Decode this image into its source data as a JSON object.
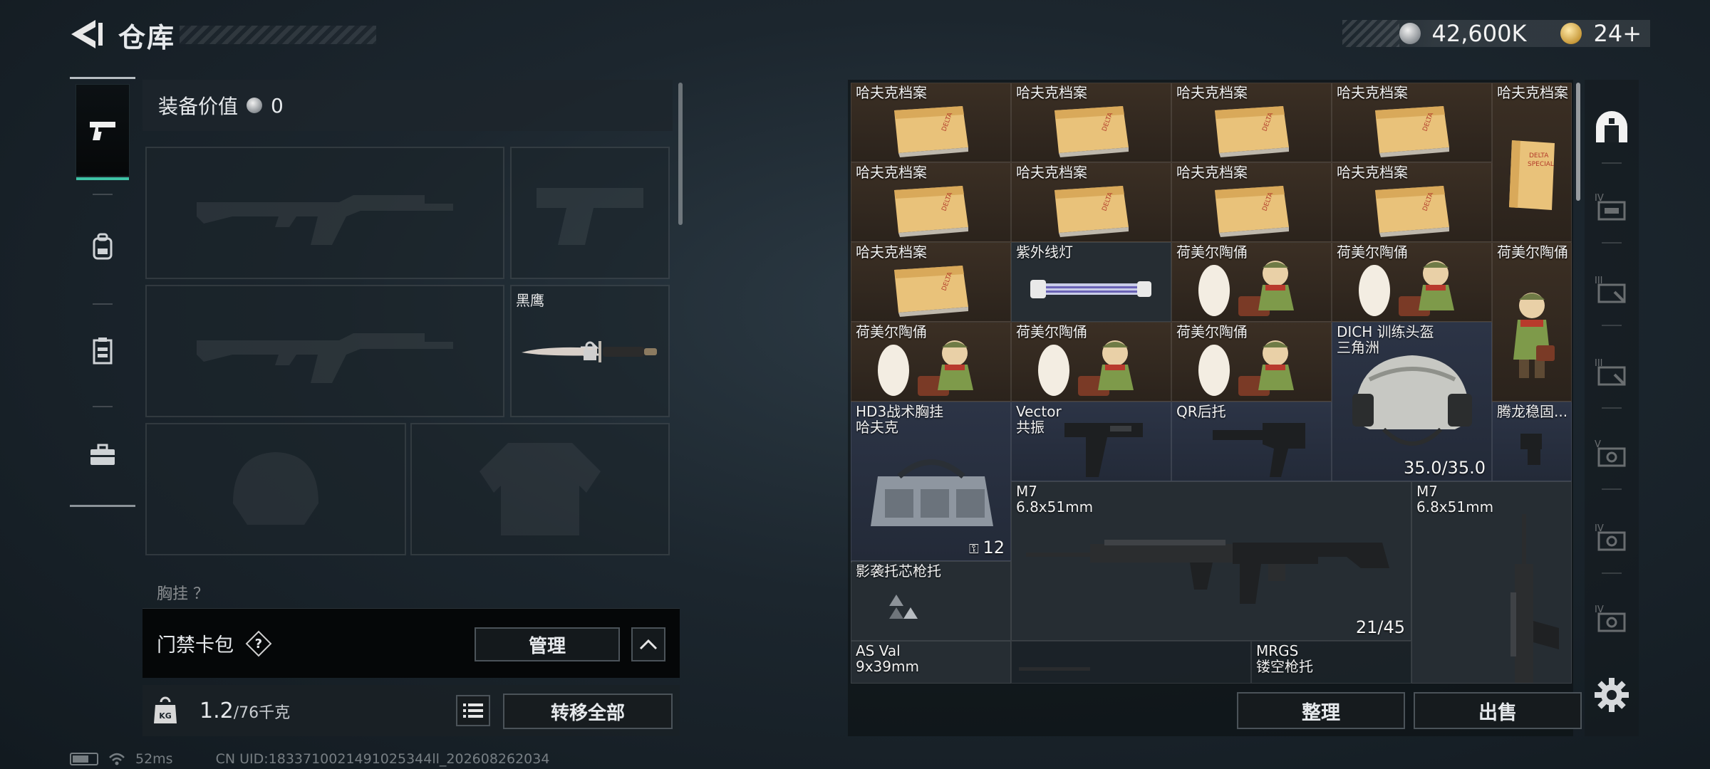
{
  "header": {
    "title": "仓库",
    "currency": [
      {
        "icon": "silver-coin-icon",
        "value": "42,600K"
      },
      {
        "icon": "gold-triangle-coin-icon",
        "value": "24+"
      }
    ]
  },
  "left_tabs": [
    {
      "icon": "pistol-icon",
      "active": true
    },
    {
      "icon": "backpack-icon",
      "active": false
    },
    {
      "icon": "vest-icon",
      "active": false
    },
    {
      "icon": "toolbox-icon",
      "active": false
    }
  ],
  "equipment": {
    "value_label": "装备价值",
    "value": "0",
    "melee_slot_label": "黑鹰",
    "chest_label": "胸挂 ？"
  },
  "keycard": {
    "title": "门禁卡包",
    "help": "?",
    "manage_label": "管理"
  },
  "capacity": {
    "current": "1.2",
    "max": "/76千克",
    "transfer_label": "转移全部"
  },
  "inventory": {
    "items": [
      {
        "name": "哈夫克档案",
        "type": "file",
        "color": "brown"
      },
      {
        "name": "哈夫克档案",
        "type": "file",
        "color": "brown"
      },
      {
        "name": "哈夫克档案",
        "type": "file",
        "color": "brown"
      },
      {
        "name": "哈夫克档案",
        "type": "file",
        "color": "brown"
      },
      {
        "name": "哈夫克档案",
        "type": "file-tall",
        "color": "brown"
      },
      {
        "name": "哈夫克档案",
        "type": "file",
        "color": "brown"
      },
      {
        "name": "哈夫克档案",
        "type": "file",
        "color": "brown"
      },
      {
        "name": "哈夫克档案",
        "type": "file",
        "color": "brown"
      },
      {
        "name": "哈夫克档案",
        "type": "file",
        "color": "brown"
      },
      {
        "name": "哈夫克档案",
        "type": "file",
        "color": "brown"
      },
      {
        "name": "紫外线灯",
        "type": "uv-lamp",
        "color": "dark"
      },
      {
        "name": "荷美尔陶俑",
        "type": "figurine",
        "color": "brown"
      },
      {
        "name": "荷美尔陶俑",
        "type": "figurine",
        "color": "brown"
      },
      {
        "name": "荷美尔陶俑",
        "type": "figurine-tall",
        "color": "brown"
      },
      {
        "name": "荷美尔陶俑",
        "type": "figurine",
        "color": "brown"
      },
      {
        "name": "荷美尔陶俑",
        "type": "figurine",
        "color": "brown"
      },
      {
        "name": "荷美尔陶俑",
        "type": "figurine",
        "color": "brown"
      },
      {
        "name": "DICH 训练头盔",
        "sub": "三角洲",
        "type": "helmet",
        "color": "blue",
        "qty": "35.0/35.0"
      },
      {
        "name": "HD3战术胸挂",
        "sub": "哈夫克",
        "type": "bag",
        "color": "blue",
        "qty": "12"
      },
      {
        "name": "Vector",
        "sub": "共振",
        "type": "grip",
        "color": "blue"
      },
      {
        "name": "QR后托",
        "type": "stock",
        "color": "blue"
      },
      {
        "name": "腾龙稳固...",
        "type": "small-part",
        "color": "blue"
      },
      {
        "name": "M7",
        "sub": "6.8x51mm",
        "type": "rifle",
        "color": "dark",
        "qty": "21/45"
      },
      {
        "name": "M7",
        "sub": "6.8x51mm",
        "type": "rifle-vertical",
        "color": "dark"
      },
      {
        "name": "影袭托芯枪托",
        "type": "triangle-part",
        "color": "dark"
      },
      {
        "name": "AS Val",
        "sub": "9x39mm",
        "type": "gun-partial",
        "color": "dark"
      },
      {
        "name": "MRGS",
        "sub": "镂空枪托",
        "type": "partial",
        "color": "dark"
      }
    ],
    "sort_label": "整理",
    "sell_label": "出售"
  },
  "right_tabs": [
    {
      "icon": "safe-box-icon",
      "active": true
    },
    {
      "icon": "storage-iv-icon",
      "active": false
    },
    {
      "icon": "storage-iii-icon",
      "active": false
    },
    {
      "icon": "storage-iii-b-icon",
      "active": false
    },
    {
      "icon": "storage-v-icon",
      "active": false
    },
    {
      "icon": "storage-iv-b-icon",
      "active": false
    },
    {
      "icon": "storage-iv-c-icon",
      "active": false
    }
  ],
  "status": {
    "ping": "52ms",
    "uid": "CN UID:1833710021491025344ll_202608262034"
  },
  "colors": {
    "accent": "#3ec3a5",
    "brown_cell": "#3b2f24",
    "blue_cell": "#2c3446"
  }
}
